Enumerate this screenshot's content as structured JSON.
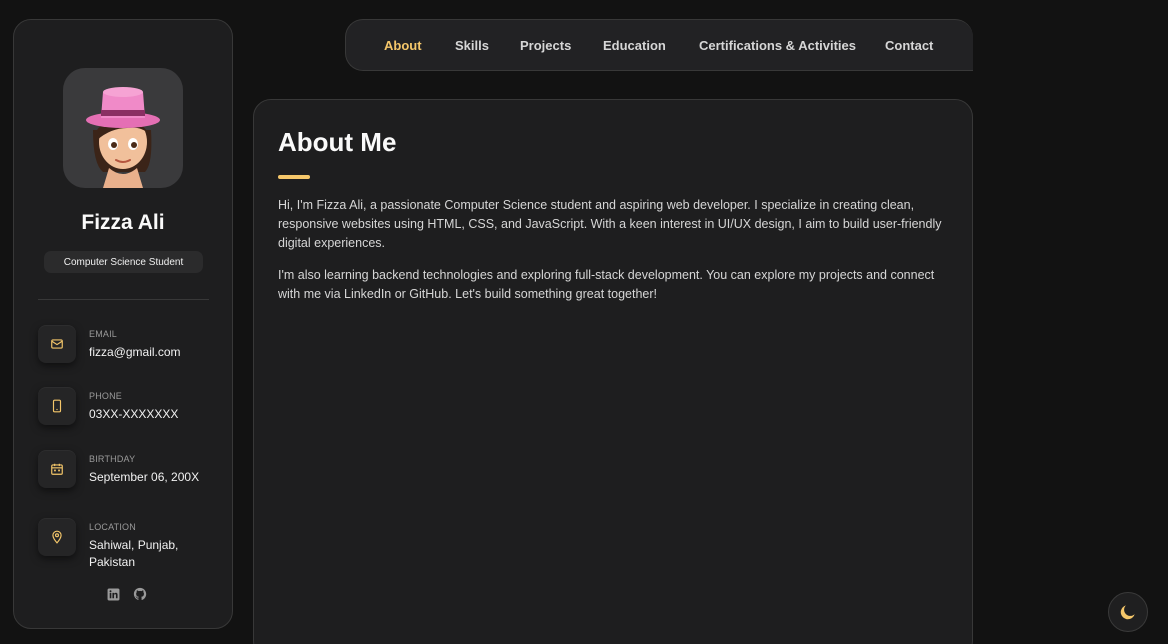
{
  "profile": {
    "name": "Fizza Ali",
    "title": "Computer Science Student"
  },
  "contacts": [
    {
      "label": "EMAIL",
      "value": "fizza@gmail.com",
      "icon": "mail-icon"
    },
    {
      "label": "PHONE",
      "value": "03XX-XXXXXXX",
      "icon": "phone-icon"
    },
    {
      "label": "BIRTHDAY",
      "value": "September 06, 200X",
      "icon": "calendar-icon"
    },
    {
      "label": "LOCATION",
      "value": "Sahiwal, Punjab, Pakistan",
      "icon": "location-pin-icon"
    }
  ],
  "social": [
    "linkedin-icon",
    "github-icon"
  ],
  "nav": {
    "items": [
      "About",
      "Skills",
      "Projects",
      "Education",
      "Certifications & Activities",
      "Contact"
    ],
    "active": "About"
  },
  "about": {
    "title": "About Me",
    "paragraphs": [
      "Hi, I'm Fizza Ali, a passionate Computer Science student and aspiring web developer. I specialize in creating clean, responsive websites using HTML, CSS, and JavaScript. With a keen interest in UI/UX design, I aim to build user-friendly digital experiences.",
      "I'm also learning backend technologies and exploring full-stack development. You can explore my projects and connect with me via LinkedIn or GitHub. Let's build something great together!"
    ]
  },
  "theme_toggle": {
    "icon": "moon-icon"
  },
  "colors": {
    "background": "#121212",
    "panel": "#1e1e1f",
    "accent": "#f5c76a",
    "text": "#d6d6d6"
  }
}
